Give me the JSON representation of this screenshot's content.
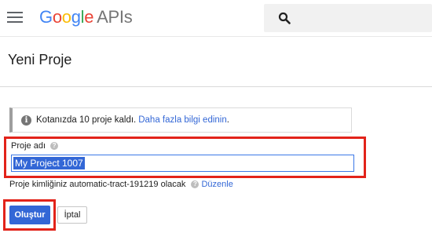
{
  "header": {
    "menu_icon": "hamburger-menu-icon",
    "brand": {
      "g1": "G",
      "g2": "o",
      "g3": "o",
      "g4": "g",
      "g5": "l",
      "g6": "e",
      "apis": "APIs"
    },
    "search_icon": "search-icon"
  },
  "page": {
    "title": "Yeni Proje"
  },
  "notice": {
    "icon": "info-icon",
    "icon_glyph": "i",
    "text": "Kotanızda 10 proje kaldı.",
    "link": "Daha fazla bilgi edinin",
    "link_suffix": "."
  },
  "form": {
    "name_label": "Proje adı",
    "help_glyph": "?",
    "name_value": "My Project 1007",
    "id_text": "Proje kimliğiniz automatic-tract-191219 olacak",
    "id_edit_link": "Düzenle"
  },
  "actions": {
    "create_label": "Oluştur",
    "cancel_label": "İptal"
  },
  "colors": {
    "primary": "#3367d6",
    "highlight": "#e2231a",
    "google_blue": "#4285f4",
    "google_red": "#ea4335",
    "google_yellow": "#fbbc05",
    "google_green": "#34a853"
  }
}
